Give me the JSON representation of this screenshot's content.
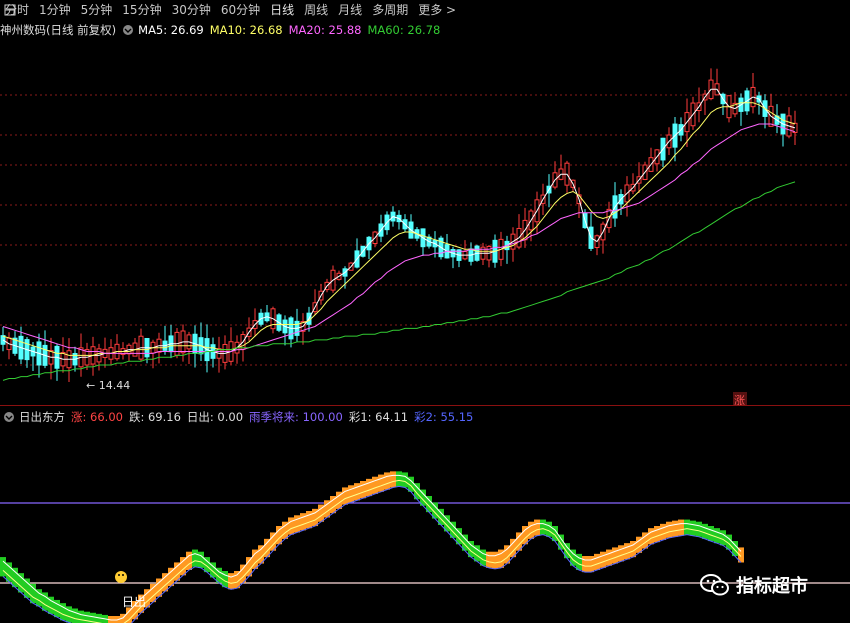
{
  "toolbar": {
    "items": [
      "分时",
      "1分钟",
      "5分钟",
      "15分钟",
      "30分钟",
      "60分钟",
      "日线",
      "周线",
      "月线",
      "多周期",
      "更多 >"
    ],
    "active_index": 6
  },
  "main_legend": {
    "title": "神州数码(日线 前复权)",
    "ma5": "MA5: 26.69",
    "ma10": "MA10: 26.68",
    "ma20": "MA20: 25.88",
    "ma60": "MA60: 26.78"
  },
  "indicator_legend": {
    "title": "日出东方",
    "zhang": "涨: 66.00",
    "die": "跌: 69.16",
    "richu": "日出: 0.00",
    "yuji": "雨季将来: 100.00",
    "cai1": "彩1: 64.11",
    "cai2": "彩2: 55.15"
  },
  "annotations": {
    "low_label": "14.44",
    "zhang_marker": "涨",
    "richu_marker": "日出"
  },
  "watermark": {
    "text": "指标超市",
    "icon": "wechat-icon"
  },
  "colors": {
    "up": "#ff3c3c",
    "down": "#54ffff",
    "ma5": "#ffffff",
    "ma10": "#ffff66",
    "ma20": "#ff66ff",
    "ma60": "#33cc33",
    "ind_up": "#ff9922",
    "ind_down": "#22cc22",
    "line_purple": "#8866ff",
    "line_pink": "#ffdddd"
  },
  "chart_data": [
    {
      "type": "candlestick",
      "title": "神州数码(日线 前复权)",
      "price_range": [
        13.5,
        31.5
      ],
      "x": [
        0,
        6,
        12,
        18,
        24,
        30,
        36,
        42,
        48,
        54,
        60,
        66,
        72,
        78,
        84,
        90,
        96,
        102,
        108,
        114,
        120,
        126,
        132,
        138,
        144,
        150,
        156,
        162,
        168,
        174,
        180,
        186,
        192,
        198,
        204,
        210,
        216,
        222,
        228,
        234,
        240,
        246,
        252,
        258,
        264,
        270,
        276,
        282,
        288,
        294,
        300,
        306,
        312,
        318,
        324,
        330,
        336,
        342,
        348,
        354,
        360,
        366,
        372,
        378,
        384,
        390,
        396,
        402,
        408,
        414,
        420,
        426,
        432,
        438,
        444,
        450,
        456,
        462,
        468,
        474,
        480,
        486,
        492,
        498,
        504,
        510,
        516,
        522,
        528,
        534,
        540,
        546,
        552,
        558,
        564,
        570,
        576,
        582,
        588,
        594,
        600,
        606,
        612,
        618,
        624,
        630,
        636,
        642,
        648,
        654,
        660,
        666,
        672,
        678,
        684,
        690,
        696,
        702,
        708,
        714,
        720,
        726,
        732,
        738,
        744,
        750,
        756,
        762,
        768,
        774,
        780,
        786,
        792,
        798,
        804,
        810,
        816,
        822,
        828,
        834,
        840,
        846
      ],
      "series": [
        {
          "name": "MA5",
          "values": [
            16.2,
            16.0,
            15.9,
            15.8,
            15.7,
            15.6,
            15.5,
            15.4,
            15.3,
            15.3,
            15.2,
            15.2,
            15.2,
            15.3,
            15.3,
            15.4,
            15.4,
            15.5,
            15.5,
            15.6,
            15.6,
            15.7,
            15.7,
            15.8,
            15.8,
            15.8,
            15.9,
            15.9,
            16.0,
            16.0,
            16.1,
            16.1,
            16.0,
            15.9,
            15.7,
            15.6,
            15.5,
            15.5,
            15.6,
            15.8,
            16.1,
            16.6,
            17.0,
            17.3,
            17.4,
            17.3,
            17.1,
            16.9,
            16.8,
            16.8,
            16.9,
            17.3,
            17.9,
            18.5,
            19.0,
            19.3,
            19.5,
            19.7,
            20.0,
            20.4,
            20.8,
            21.2,
            21.5,
            21.9,
            22.3,
            22.6,
            22.5,
            22.2,
            21.9,
            21.7,
            21.5,
            21.3,
            21.2,
            21.0,
            20.8,
            20.7,
            20.6,
            20.6,
            20.6,
            20.7,
            20.7,
            20.7,
            20.8,
            20.9,
            21.1,
            21.3,
            21.5,
            21.9,
            22.4,
            22.9,
            23.5,
            24.0,
            24.5,
            24.8,
            24.8,
            24.3,
            23.5,
            22.4,
            21.5,
            21.3,
            21.8,
            22.5,
            23.1,
            23.5,
            23.8,
            24.1,
            24.5,
            24.9,
            25.3,
            25.7,
            26.1,
            26.5,
            26.8,
            27.1,
            27.5,
            27.9,
            28.3,
            28.8,
            29.2,
            29.2,
            28.7,
            28.3,
            28.2,
            28.4,
            28.6,
            28.8,
            28.7,
            28.2,
            27.8,
            27.6,
            27.4,
            27.3,
            27.2
          ]
        },
        {
          "name": "MA10",
          "values": [
            16.4,
            16.3,
            16.2,
            16.1,
            16.0,
            15.9,
            15.8,
            15.7,
            15.6,
            15.5,
            15.5,
            15.4,
            15.4,
            15.4,
            15.4,
            15.4,
            15.5,
            15.5,
            15.5,
            15.6,
            15.6,
            15.6,
            15.7,
            15.7,
            15.7,
            15.8,
            15.8,
            15.8,
            15.9,
            15.9,
            15.9,
            15.9,
            15.9,
            15.9,
            15.8,
            15.8,
            15.7,
            15.7,
            15.7,
            15.8,
            15.9,
            16.1,
            16.4,
            16.7,
            16.9,
            17.0,
            17.0,
            17.0,
            17.0,
            17.0,
            17.1,
            17.2,
            17.5,
            17.8,
            18.2,
            18.5,
            18.8,
            19.1,
            19.4,
            19.7,
            20.0,
            20.3,
            20.6,
            20.9,
            21.2,
            21.5,
            21.7,
            21.8,
            21.8,
            21.7,
            21.6,
            21.5,
            21.4,
            21.3,
            21.2,
            21.1,
            21.0,
            20.9,
            20.9,
            20.8,
            20.8,
            20.8,
            20.8,
            20.9,
            21.0,
            21.1,
            21.3,
            21.5,
            21.8,
            22.1,
            22.5,
            22.9,
            23.3,
            23.6,
            23.8,
            23.9,
            23.7,
            23.3,
            22.9,
            22.6,
            22.5,
            22.6,
            22.8,
            23.0,
            23.3,
            23.6,
            23.9,
            24.2,
            24.5,
            24.8,
            25.1,
            25.4,
            25.8,
            26.1,
            26.5,
            26.9,
            27.2,
            27.6,
            28.0,
            28.2,
            28.3,
            28.3,
            28.4,
            28.5,
            28.5,
            28.5,
            28.4,
            28.2,
            28.0,
            27.8,
            27.6,
            27.5,
            27.4
          ]
        },
        {
          "name": "MA20",
          "values": [
            16.9,
            16.8,
            16.7,
            16.6,
            16.5,
            16.4,
            16.3,
            16.2,
            16.1,
            16.0,
            15.9,
            15.8,
            15.8,
            15.7,
            15.6,
            15.6,
            15.6,
            15.5,
            15.5,
            15.5,
            15.5,
            15.5,
            15.5,
            15.5,
            15.5,
            15.5,
            15.6,
            15.6,
            15.6,
            15.6,
            15.6,
            15.6,
            15.6,
            15.6,
            15.6,
            15.6,
            15.6,
            15.6,
            15.6,
            15.7,
            15.7,
            15.8,
            15.9,
            16.0,
            16.1,
            16.2,
            16.3,
            16.4,
            16.5,
            16.6,
            16.7,
            16.8,
            16.9,
            17.1,
            17.3,
            17.5,
            17.7,
            17.9,
            18.1,
            18.4,
            18.6,
            18.9,
            19.2,
            19.4,
            19.7,
            19.9,
            20.1,
            20.3,
            20.4,
            20.5,
            20.6,
            20.6,
            20.7,
            20.7,
            20.8,
            20.8,
            20.8,
            20.8,
            20.9,
            20.9,
            20.9,
            20.9,
            21.0,
            21.0,
            21.1,
            21.2,
            21.3,
            21.4,
            21.6,
            21.7,
            21.9,
            22.1,
            22.3,
            22.5,
            22.6,
            22.7,
            22.8,
            22.8,
            22.8,
            22.8,
            22.8,
            22.9,
            22.9,
            23.0,
            23.1,
            23.2,
            23.3,
            23.5,
            23.7,
            23.9,
            24.1,
            24.3,
            24.5,
            24.8,
            25.0,
            25.3,
            25.5,
            25.8,
            26.1,
            26.3,
            26.5,
            26.7,
            26.9,
            27.1,
            27.2,
            27.3,
            27.4,
            27.4,
            27.4,
            27.3,
            27.2,
            27.1,
            27.0
          ]
        },
        {
          "name": "MA60",
          "values": [
            14.1,
            14.2,
            14.2,
            14.3,
            14.3,
            14.4,
            14.4,
            14.5,
            14.5,
            14.6,
            14.6,
            14.6,
            14.7,
            14.7,
            14.8,
            14.8,
            14.9,
            14.9,
            14.9,
            15.0,
            15.0,
            15.1,
            15.1,
            15.1,
            15.2,
            15.2,
            15.3,
            15.3,
            15.3,
            15.4,
            15.4,
            15.5,
            15.5,
            15.5,
            15.6,
            15.6,
            15.7,
            15.7,
            15.7,
            15.8,
            15.8,
            15.8,
            15.9,
            15.9,
            15.9,
            16.0,
            16.0,
            16.0,
            16.0,
            16.1,
            16.1,
            16.1,
            16.2,
            16.2,
            16.2,
            16.3,
            16.3,
            16.4,
            16.4,
            16.4,
            16.5,
            16.5,
            16.5,
            16.6,
            16.6,
            16.7,
            16.7,
            16.8,
            16.8,
            16.8,
            16.9,
            16.9,
            17.0,
            17.0,
            17.1,
            17.1,
            17.2,
            17.2,
            17.3,
            17.3,
            17.4,
            17.4,
            17.5,
            17.6,
            17.6,
            17.7,
            17.8,
            17.9,
            18.0,
            18.1,
            18.2,
            18.3,
            18.4,
            18.5,
            18.7,
            18.8,
            18.9,
            19.0,
            19.1,
            19.2,
            19.3,
            19.4,
            19.6,
            19.7,
            19.9,
            20.0,
            20.1,
            20.3,
            20.4,
            20.6,
            20.8,
            20.9,
            21.1,
            21.3,
            21.5,
            21.7,
            21.8,
            22.0,
            22.2,
            22.4,
            22.6,
            22.8,
            23.0,
            23.1,
            23.3,
            23.5,
            23.6,
            23.8,
            23.9,
            24.1,
            24.2,
            24.3,
            24.4
          ]
        }
      ],
      "annotations": [
        "14.44",
        "涨"
      ]
    },
    {
      "type": "area",
      "title": "日出东方",
      "ylim": [
        0,
        100
      ],
      "reference_levels": [
        100,
        0
      ],
      "x": [
        0,
        6,
        12,
        18,
        24,
        30,
        36,
        42,
        48,
        54,
        60,
        66,
        72,
        78,
        84,
        90,
        96,
        102,
        108,
        114,
        120,
        126,
        132,
        138,
        144,
        150,
        156,
        162,
        168,
        174,
        180,
        186,
        192,
        198,
        204,
        210,
        216,
        222,
        228,
        234,
        240,
        246,
        252,
        258,
        264,
        270,
        276,
        282,
        288,
        294,
        300,
        306,
        312,
        318,
        324,
        330,
        336,
        342,
        348,
        354,
        360,
        366,
        372,
        378,
        384,
        390,
        396,
        402,
        408,
        414,
        420,
        426,
        432,
        438,
        444,
        450,
        456,
        462,
        468,
        474,
        480,
        486,
        492,
        498,
        504,
        510,
        516,
        522,
        528,
        534,
        540,
        546,
        552,
        558,
        564,
        570,
        576,
        582,
        588,
        594,
        600,
        606,
        612,
        618,
        624,
        630,
        636,
        642,
        648,
        654,
        660,
        666,
        672,
        678,
        684,
        690,
        696,
        702,
        708,
        714,
        720,
        726,
        732,
        738,
        744,
        750,
        756,
        762,
        768,
        774,
        780,
        786,
        792,
        798,
        804,
        810,
        816,
        822,
        828,
        834,
        840,
        846
      ],
      "series": [
        {
          "name": "彩1",
          "values": [
            55,
            50,
            45,
            40,
            35,
            30,
            25,
            22,
            18,
            15,
            12,
            9,
            7,
            5,
            4,
            3,
            2,
            1,
            0,
            0,
            2,
            8,
            14,
            20,
            25,
            30,
            35,
            40,
            45,
            50,
            55,
            60,
            62,
            60,
            55,
            50,
            45,
            42,
            40,
            42,
            48,
            55,
            62,
            66,
            72,
            78,
            84,
            88,
            92,
            94,
            96,
            98,
            100,
            104,
            108,
            112,
            116,
            120,
            122,
            124,
            126,
            128,
            130,
            132,
            134,
            135,
            135,
            134,
            130,
            124,
            118,
            112,
            106,
            100,
            94,
            88,
            82,
            76,
            70,
            66,
            62,
            60,
            60,
            62,
            66,
            72,
            78,
            84,
            88,
            90,
            90,
            88,
            84,
            76,
            68,
            62,
            58,
            56,
            56,
            58,
            60,
            62,
            64,
            66,
            68,
            70,
            74,
            78,
            82,
            84,
            86,
            88,
            89,
            90,
            90,
            89,
            88,
            86,
            84,
            82,
            80,
            76,
            70,
            64
          ]
        },
        {
          "name": "彩2",
          "values": [
            50,
            45,
            40,
            35,
            30,
            25,
            22,
            18,
            15,
            12,
            9,
            7,
            5,
            4,
            3,
            2,
            1,
            0,
            0,
            0,
            0,
            4,
            10,
            16,
            21,
            26,
            31,
            36,
            41,
            46,
            51,
            56,
            59,
            58,
            54,
            49,
            44,
            40,
            38,
            39,
            44,
            50,
            57,
            62,
            68,
            74,
            80,
            85,
            89,
            91,
            93,
            95,
            97,
            101,
            105,
            109,
            113,
            117,
            119,
            121,
            123,
            125,
            127,
            129,
            131,
            133,
            134,
            133,
            129,
            122,
            116,
            110,
            104,
            98,
            92,
            86,
            80,
            74,
            68,
            64,
            60,
            58,
            57,
            58,
            62,
            68,
            74,
            80,
            85,
            88,
            89,
            87,
            83,
            75,
            67,
            60,
            56,
            54,
            54,
            56,
            58,
            60,
            62,
            64,
            66,
            68,
            72,
            76,
            80,
            82,
            84,
            86,
            87,
            88,
            89,
            88,
            87,
            85,
            83,
            81,
            79,
            75,
            69,
            63
          ]
        }
      ],
      "annotations": [
        "日出"
      ]
    }
  ]
}
